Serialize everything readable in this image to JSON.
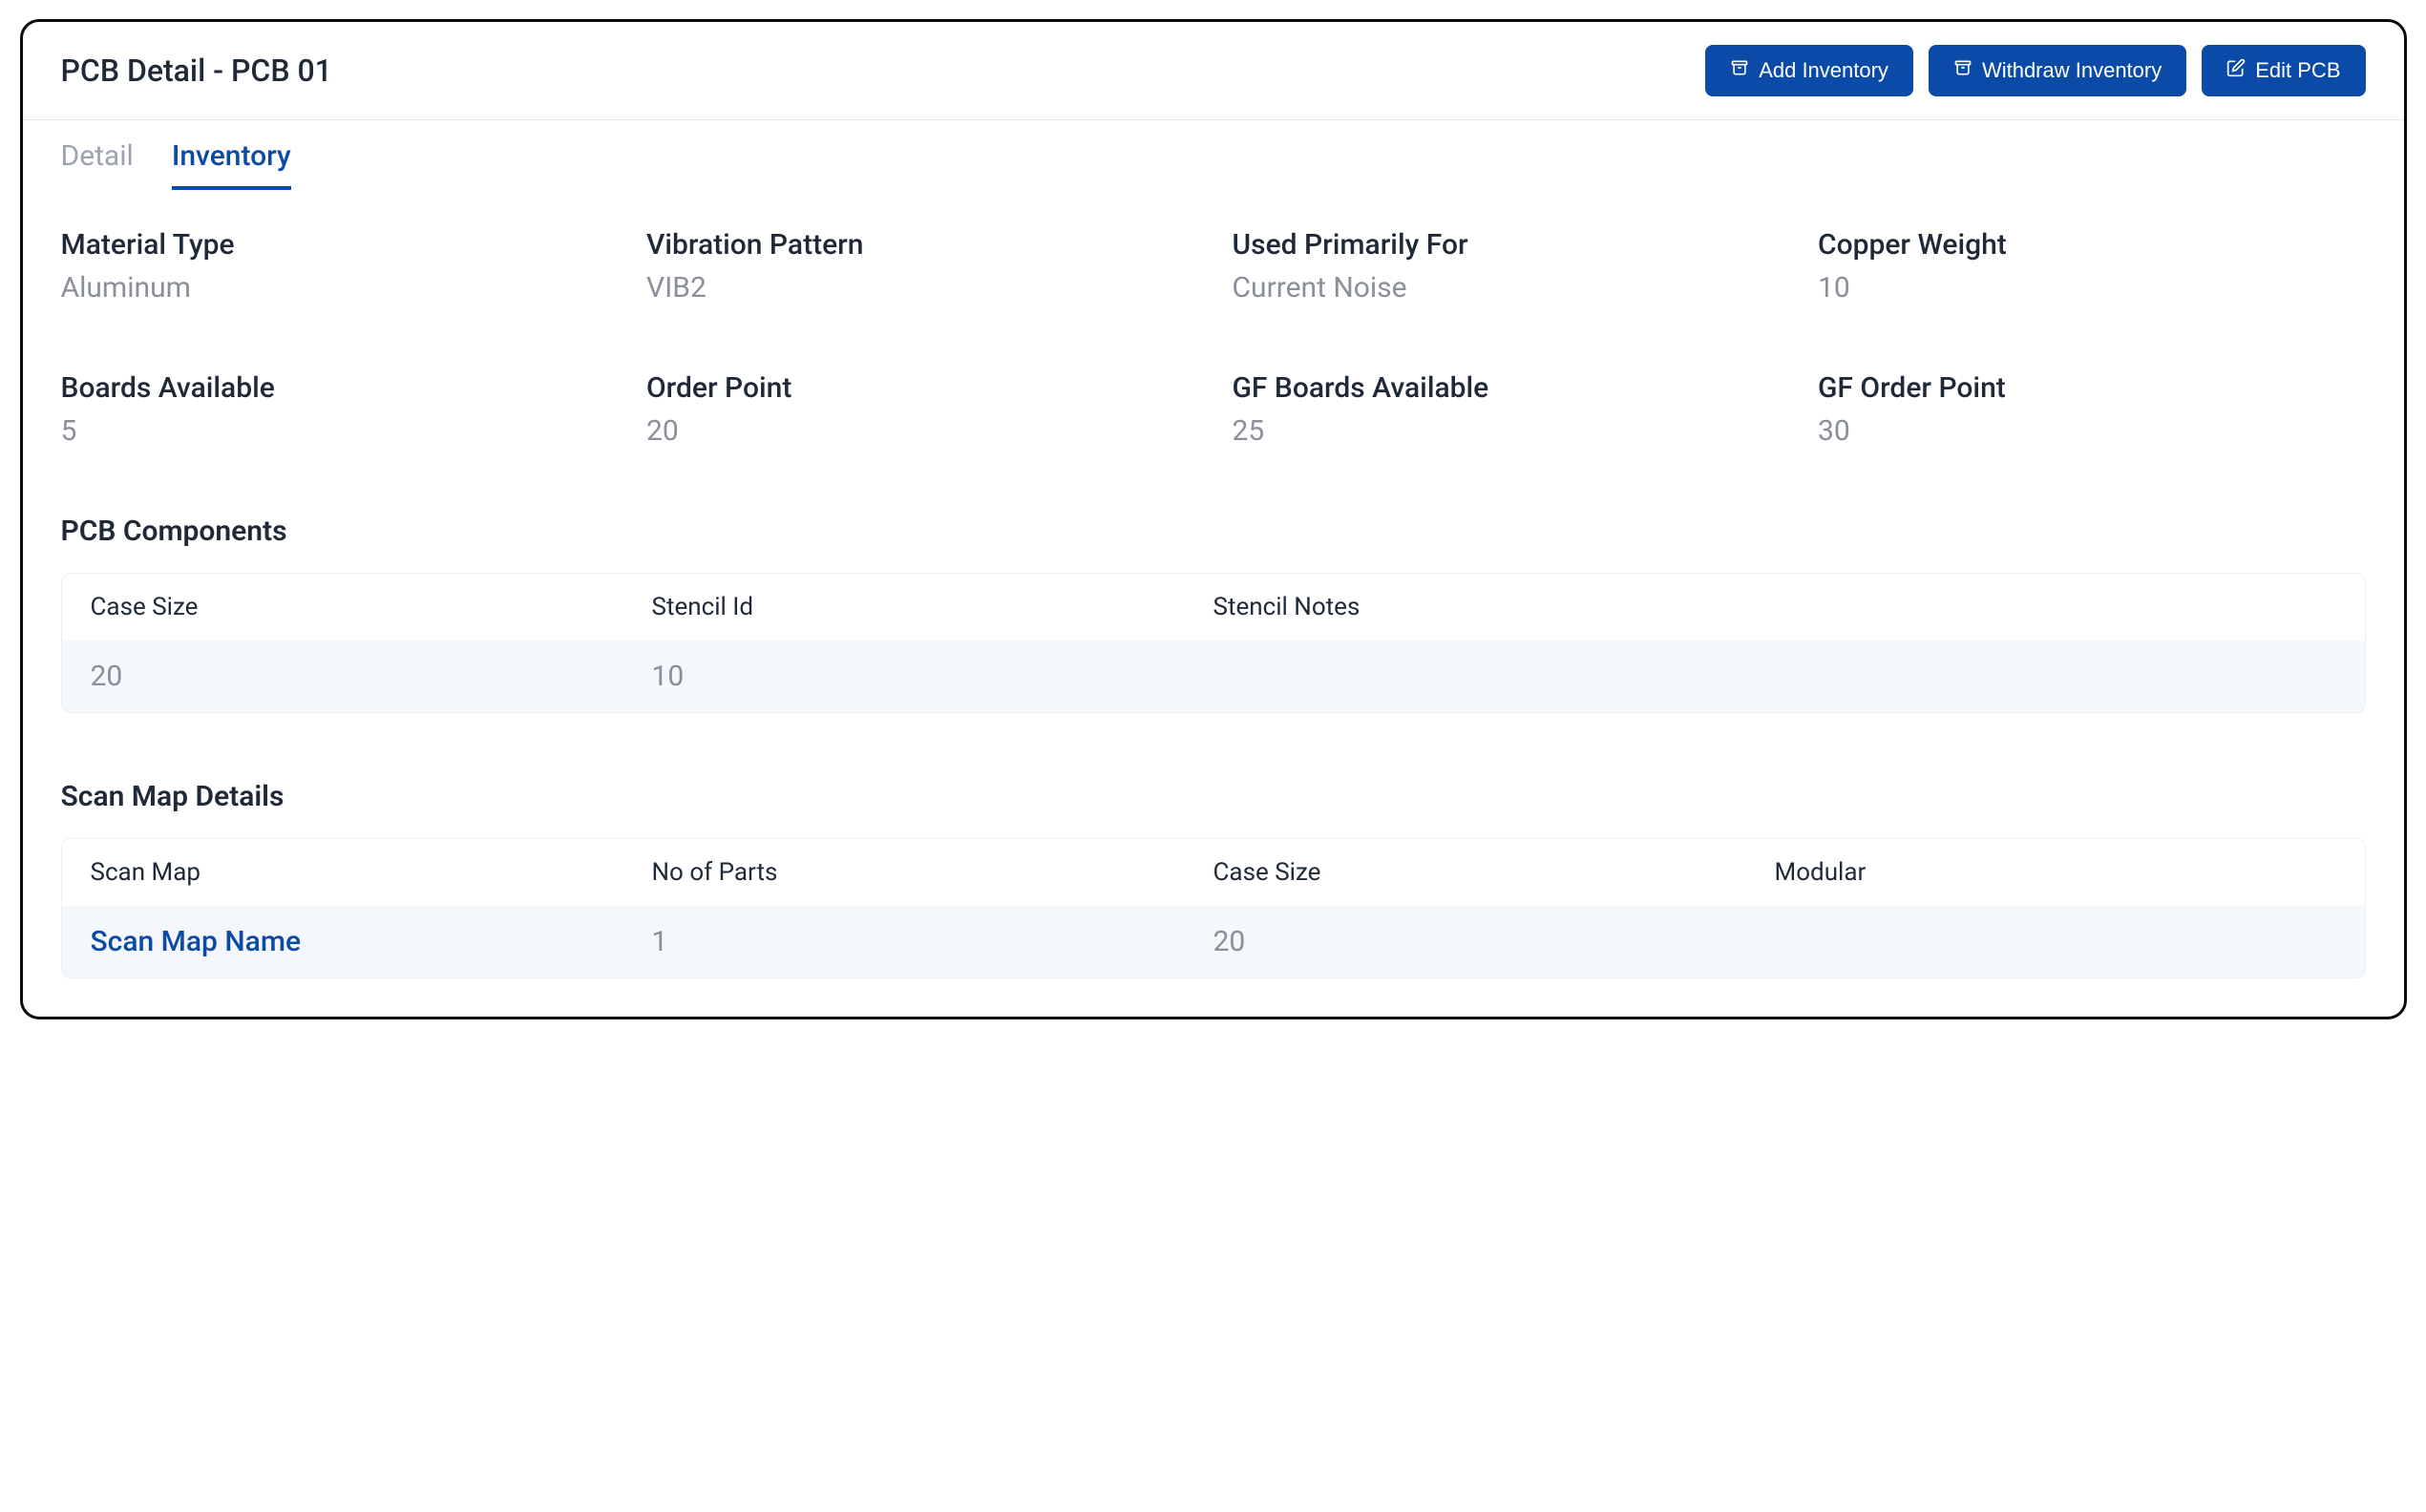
{
  "header": {
    "title": "PCB Detail - PCB 01",
    "actions": {
      "add": "Add Inventory",
      "withdraw": "Withdraw Inventory",
      "edit": "Edit PCB"
    }
  },
  "tabs": {
    "detail": "Detail",
    "inventory": "Inventory"
  },
  "fields": {
    "material_type": {
      "label": "Material Type",
      "value": "Aluminum"
    },
    "vibration_pattern": {
      "label": "Vibration Pattern",
      "value": "VIB2"
    },
    "used_primarily_for": {
      "label": "Used Primarily For",
      "value": "Current Noise"
    },
    "copper_weight": {
      "label": "Copper Weight",
      "value": "10"
    },
    "boards_available": {
      "label": "Boards Available",
      "value": "5"
    },
    "order_point": {
      "label": "Order Point",
      "value": "20"
    },
    "gf_boards_available": {
      "label": "GF Boards Available",
      "value": "25"
    },
    "gf_order_point": {
      "label": "GF Order Point",
      "value": "30"
    }
  },
  "components": {
    "title": "PCB Components",
    "headers": {
      "case_size": "Case Size",
      "stencil_id": "Stencil Id",
      "stencil_notes": "Stencil Notes"
    },
    "row": {
      "case_size": "20",
      "stencil_id": "10",
      "stencil_notes": ""
    }
  },
  "scan_map": {
    "title": "Scan Map Details",
    "headers": {
      "scan_map": "Scan Map",
      "no_of_parts": "No of Parts",
      "case_size": "Case Size",
      "modular": "Modular"
    },
    "row": {
      "scan_map": "Scan Map Name",
      "no_of_parts": "1",
      "case_size": "20",
      "modular": ""
    }
  }
}
